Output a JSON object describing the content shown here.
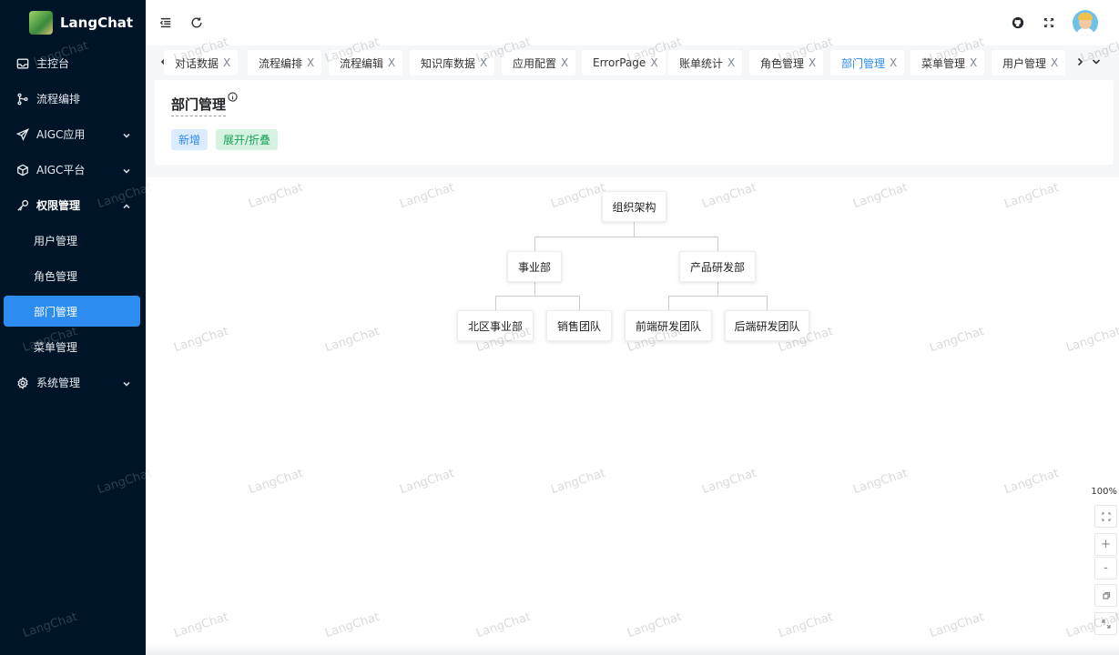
{
  "app": {
    "name": "LangChat"
  },
  "sidebar": {
    "items": [
      {
        "label": "主控台",
        "icon": "inbox-icon"
      },
      {
        "label": "流程编排",
        "icon": "branch-icon"
      },
      {
        "label": "AIGC应用",
        "icon": "send-icon",
        "expandable": true
      },
      {
        "label": "AIGC平台",
        "icon": "cube-icon",
        "expandable": true
      },
      {
        "label": "权限管理",
        "icon": "key-icon",
        "expandable": true,
        "open": true
      },
      {
        "label": "系统管理",
        "icon": "gear-icon",
        "expandable": true
      }
    ],
    "sub_items": [
      "用户管理",
      "角色管理",
      "部门管理",
      "菜单管理"
    ],
    "active_sub": "部门管理"
  },
  "header": {
    "collapse_icon": "menu-collapse-icon",
    "refresh_icon": "refresh-icon",
    "right_icons": [
      "github-icon",
      "fullscreen-icon"
    ]
  },
  "tabs": {
    "items": [
      "对话数据",
      "流程编排",
      "流程编辑",
      "知识库数据",
      "应用配置",
      "ErrorPage",
      "账单统计",
      "角色管理",
      "部门管理",
      "菜单管理",
      "用户管理"
    ],
    "active": "部门管理",
    "close_glyph": "X"
  },
  "page": {
    "title": "部门管理",
    "add_label": "新增",
    "toggle_label": "展开/折叠",
    "colors": {
      "primary": "#2d8cf0",
      "success": "#18a058",
      "sidebar_bg": "#001428"
    }
  },
  "org_chart": {
    "root": "组织架构",
    "level1": [
      "事业部",
      "产品研发部"
    ],
    "level2": [
      "北区事业部",
      "销售团队",
      "前端研发团队",
      "后端研发团队"
    ]
  },
  "zoom": {
    "level": "100%",
    "zoom_in": "+",
    "zoom_out": "-"
  },
  "watermark": "LangChat"
}
